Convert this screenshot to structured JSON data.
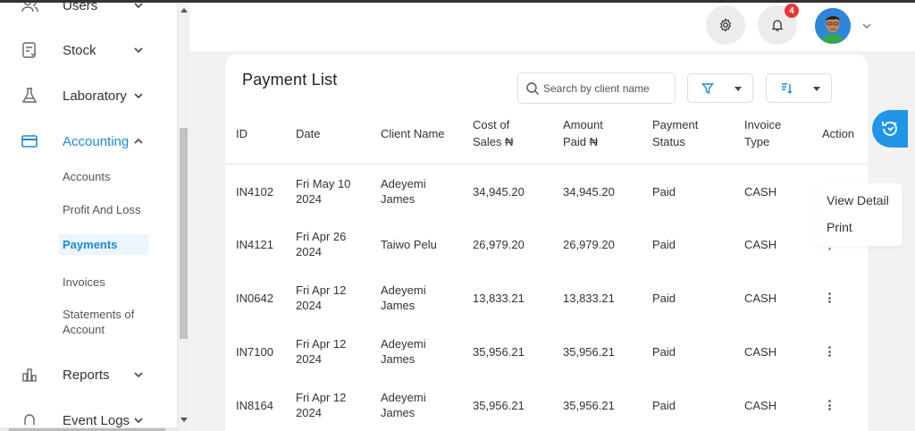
{
  "sidebar": {
    "items": [
      {
        "label": "Users",
        "icon": "users-icon"
      },
      {
        "label": "Stock",
        "icon": "stock-icon"
      },
      {
        "label": "Laboratory",
        "icon": "flask-icon"
      },
      {
        "label": "Accounting",
        "icon": "credit-card-icon"
      },
      {
        "label": "Reports",
        "icon": "bar-chart-icon"
      },
      {
        "label": "Event Logs",
        "icon": "bell-icon"
      }
    ],
    "accounting_sub": [
      "Accounts",
      "Profit And Loss",
      "Payments",
      "Invoices",
      "Statements of",
      "Account"
    ]
  },
  "header": {
    "notification_count": "4"
  },
  "page": {
    "title": "Payment List",
    "search_placeholder": "Search by client name"
  },
  "table": {
    "columns": [
      {
        "line1": "ID",
        "line2": ""
      },
      {
        "line1": "Date",
        "line2": ""
      },
      {
        "line1": "Client Name",
        "line2": ""
      },
      {
        "line1": "Cost of",
        "line2": "Sales ₦"
      },
      {
        "line1": "Amount",
        "line2": "Paid ₦"
      },
      {
        "line1": "Payment",
        "line2": "Status"
      },
      {
        "line1": "Invoice",
        "line2": "Type"
      },
      {
        "line1": "Action",
        "line2": ""
      }
    ],
    "rows": [
      {
        "id": "IN4102",
        "date1": "Fri May 10",
        "date2": "2024",
        "client1": "Adeyemi",
        "client2": "James",
        "cost": "34,945.20",
        "paid": "34,945.20",
        "status": "Paid",
        "type": "CASH"
      },
      {
        "id": "IN4121",
        "date1": "Fri Apr 26",
        "date2": "2024",
        "client1": "Taiwo Pelu",
        "client2": "",
        "cost": "26,979.20",
        "paid": "26,979.20",
        "status": "Paid",
        "type": "CASH"
      },
      {
        "id": "IN0642",
        "date1": "Fri Apr 12",
        "date2": "2024",
        "client1": "Adeyemi",
        "client2": "James",
        "cost": "13,833.21",
        "paid": "13,833.21",
        "status": "Paid",
        "type": "CASH"
      },
      {
        "id": "IN7100",
        "date1": "Fri Apr 12",
        "date2": "2024",
        "client1": "Adeyemi",
        "client2": "James",
        "cost": "35,956.21",
        "paid": "35,956.21",
        "status": "Paid",
        "type": "CASH"
      },
      {
        "id": "IN8164",
        "date1": "Fri Apr 12",
        "date2": "2024",
        "client1": "Adeyemi",
        "client2": "James",
        "cost": "35,956.21",
        "paid": "35,956.21",
        "status": "Paid",
        "type": "CASH"
      }
    ]
  },
  "action_menu": {
    "items": [
      "View Detail",
      "Print"
    ]
  },
  "colors": {
    "accent": "#1c8ad6",
    "fab": "#2196e8",
    "badge": "#e53935"
  }
}
